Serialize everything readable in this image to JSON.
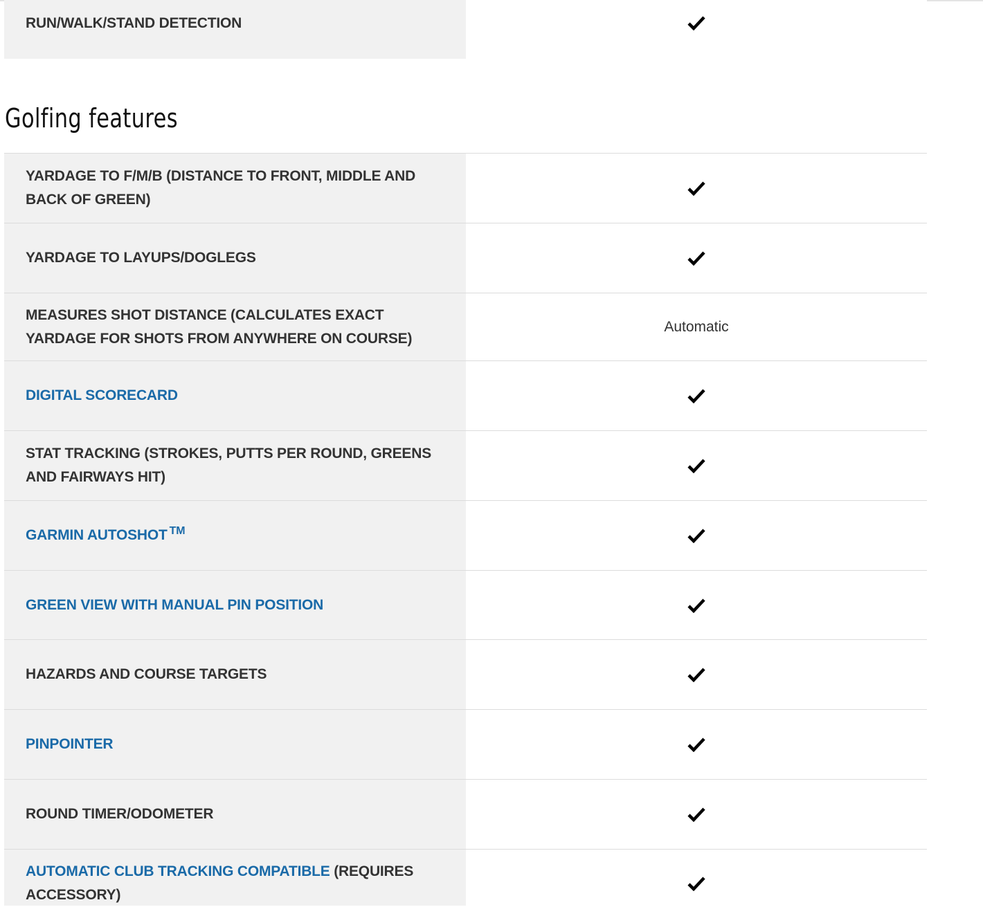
{
  "first_row": {
    "label": "RUN/WALK/STAND DETECTION",
    "value_icon": "check-icon"
  },
  "section": {
    "title": "Golfing features"
  },
  "rows": [
    {
      "label": "YARDAGE TO F/M/B (DISTANCE TO FRONT, MIDDLE AND BACK OF GREEN)",
      "value_icon": "check-icon"
    },
    {
      "label": "YARDAGE TO LAYUPS/DOGLEGS",
      "value_icon": "check-icon"
    },
    {
      "label": "MEASURES SHOT DISTANCE (CALCULATES EXACT YARDAGE FOR SHOTS FROM ANYWHERE ON COURSE)",
      "value_text": "Automatic"
    },
    {
      "link_label": "DIGITAL SCORECARD",
      "value_icon": "check-icon"
    },
    {
      "label": "STAT TRACKING (STROKES, PUTTS PER ROUND, GREENS AND FAIRWAYS HIT)",
      "value_icon": "check-icon"
    },
    {
      "link_label": "GARMIN AUTOSHOT",
      "trademark": "TM",
      "value_icon": "check-icon"
    },
    {
      "link_label": "GREEN VIEW WITH MANUAL PIN POSITION",
      "value_icon": "check-icon"
    },
    {
      "label": "HAZARDS AND COURSE TARGETS",
      "value_icon": "check-icon"
    },
    {
      "link_label": "PINPOINTER",
      "value_icon": "check-icon"
    },
    {
      "label": "ROUND TIMER/ODOMETER",
      "value_icon": "check-icon"
    },
    {
      "link_label": "AUTOMATIC CLUB TRACKING COMPATIBLE",
      "label_suffix": " (REQUIRES ACCESSORY)",
      "value_icon": "check-icon"
    }
  ],
  "colors": {
    "label_bg": "#f1f1f1",
    "link": "#1a6aa8",
    "text": "#333333",
    "divider": "#dcdcdc"
  }
}
